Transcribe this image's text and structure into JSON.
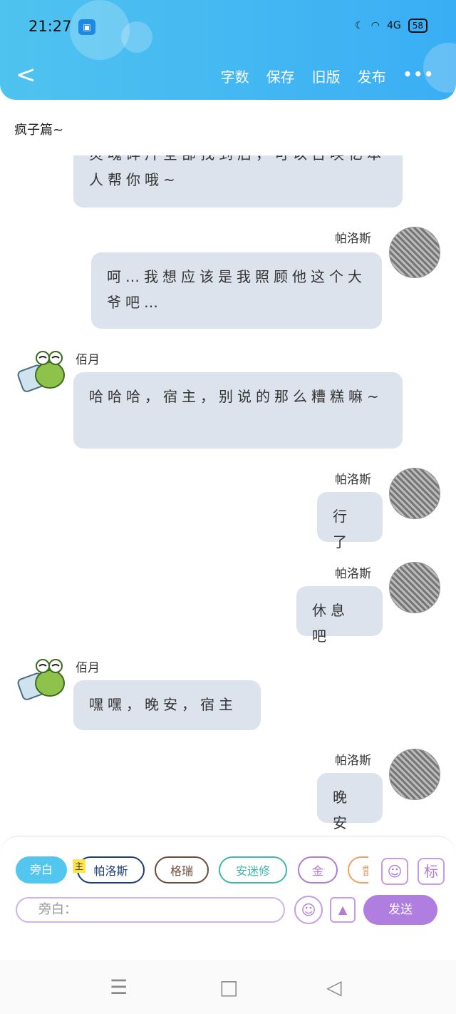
{
  "status_bar": {
    "time": "21:27",
    "network": "4G",
    "battery": "58"
  },
  "toolbar": {
    "back_icon": "chevron-left-icon",
    "word_count": "字数",
    "save": "保存",
    "old_version": "旧版",
    "publish": "发布",
    "more": "•••"
  },
  "chapter_title": "疯子篇~",
  "messages": [
    {
      "side": "left",
      "name": "",
      "text": "灵魂碎片全部找到后，可以召唤亿本人帮你哦~"
    },
    {
      "side": "right",
      "name": "帕洛斯",
      "text": "呵…我想应该是我照顾他这个大爷吧…"
    },
    {
      "side": "left",
      "name": "佰月",
      "text": "哈哈哈，宿主，别说的那么糟糕嘛~"
    },
    {
      "side": "right",
      "name": "帕洛斯",
      "text": "行了"
    },
    {
      "side": "right",
      "name": "帕洛斯",
      "text": "休息吧"
    },
    {
      "side": "left",
      "name": "佰月",
      "text": "嘿嘿，晚安，宿主"
    },
    {
      "side": "right",
      "name": "帕洛斯",
      "text": "晚安"
    }
  ],
  "composer": {
    "chips": [
      "旁白",
      "帕洛斯",
      "格瑞",
      "安迷修",
      "金",
      "雷"
    ],
    "main_tag": "主",
    "input_placeholder": "旁白：",
    "send": "发送",
    "side_icon_label": "标"
  },
  "colors": {
    "header": "#3aaef4",
    "bubble": "#dde3ed",
    "accent": "#b07ee0",
    "narration_chip": "#52c6ee"
  }
}
